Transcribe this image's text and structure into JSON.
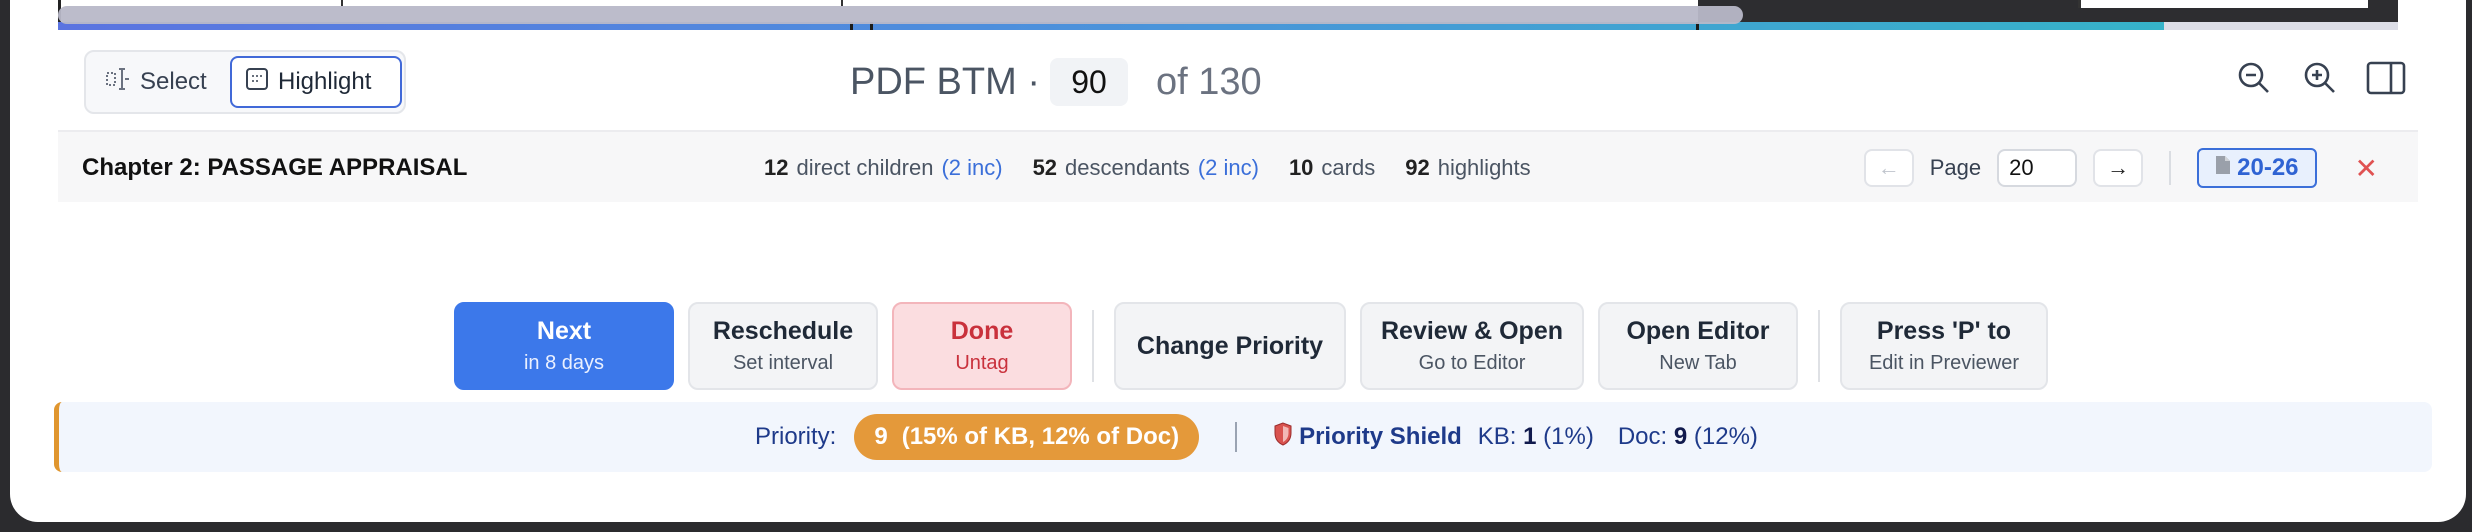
{
  "progress": {
    "reading_fraction": 0.9,
    "scroll_fraction": 0.72
  },
  "mode": {
    "select_label": "Select",
    "highlight_label": "Highlight",
    "active": "highlight"
  },
  "document": {
    "title": "PDF BTM ·",
    "current_page": "90",
    "total_label": "of 130"
  },
  "tools": {
    "zoom_out_icon": "zoom-out-icon",
    "zoom_in_icon": "zoom-in-icon",
    "sidebar_icon": "sidebar-toggle-icon"
  },
  "info": {
    "chapter": "Chapter 2: PASSAGE APPRAISAL",
    "stats": [
      {
        "count": "12",
        "label": "direct children",
        "inc": "(2 inc)"
      },
      {
        "count": "52",
        "label": "descendants",
        "inc": "(2 inc)"
      },
      {
        "count": "10",
        "label": "cards",
        "inc": ""
      },
      {
        "count": "92",
        "label": "highlights",
        "inc": ""
      }
    ],
    "page_label": "Page",
    "page_value": "20",
    "range": "20-26"
  },
  "actions": {
    "next": {
      "main": "Next",
      "sub": "in 8 days"
    },
    "reschedule": {
      "main": "Reschedule",
      "sub": "Set interval"
    },
    "done": {
      "main": "Done",
      "sub": "Untag"
    },
    "change_priority": {
      "main": "Change Priority"
    },
    "review_open": {
      "main": "Review & Open",
      "sub": "Go to Editor"
    },
    "open_editor": {
      "main": "Open Editor",
      "sub": "New Tab"
    },
    "press_p": {
      "main": "Press 'P' to",
      "sub": "Edit in Previewer"
    }
  },
  "priority": {
    "label": "Priority:",
    "value": "9",
    "detail": "(15% of KB, 12% of Doc)",
    "shield_label": "Priority Shield",
    "kb_label": "KB:",
    "kb_value": "1",
    "kb_pct": "(1%)",
    "doc_label": "Doc:",
    "doc_value": "9",
    "doc_pct": "(12%)"
  },
  "colors": {
    "accent": "#3c78ea",
    "done": "#c9313c",
    "priority": "#e4993a",
    "link": "#3b6fd9"
  }
}
